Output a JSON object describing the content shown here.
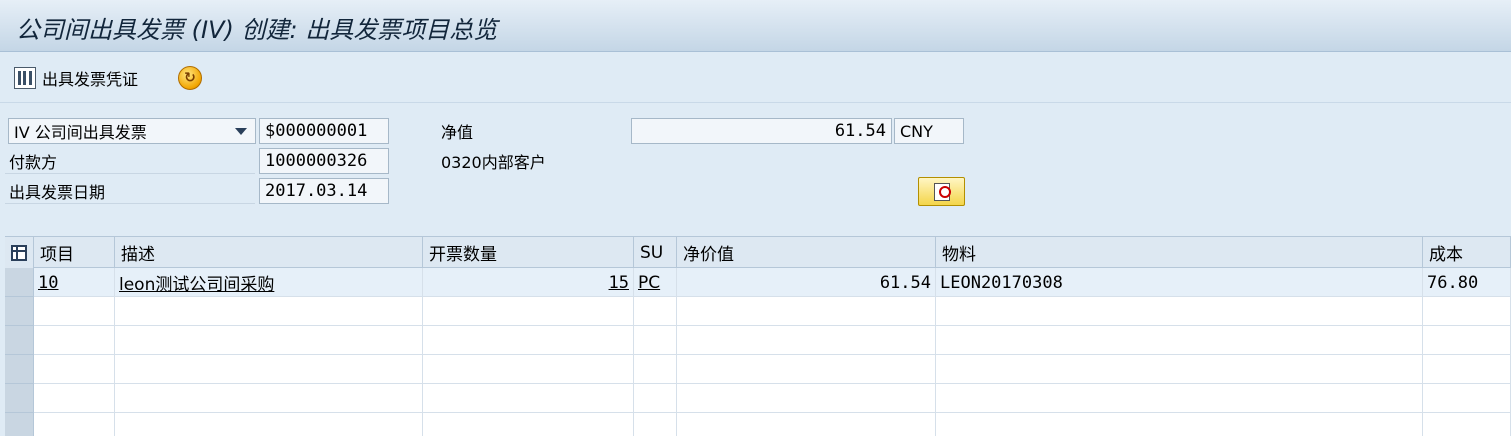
{
  "window": {
    "title": "公司间出具发票 (IV) 创建: 出具发票项目总览"
  },
  "toolbar": {
    "billing_doc_label": "出具发票凭证",
    "billing_doc_icon": "document-columns-icon",
    "refresh_icon": "refresh-icon"
  },
  "header": {
    "billing_type": "IV 公司间出具发票",
    "billing_number": "$000000001",
    "payer_label": "付款方",
    "payer_value": "1000000326",
    "billing_date_label": "出具发票日期",
    "billing_date_value": "2017.03.14",
    "net_value_label": "净值",
    "net_value": "61.54",
    "currency": "CNY",
    "customer_text": "0320内部客户",
    "details_icon": "display-document-icon"
  },
  "table": {
    "columns": [
      "项目",
      "描述",
      "开票数量",
      "SU",
      "净价值",
      "物料",
      "成本"
    ],
    "rows": [
      {
        "item": "10",
        "description": "leon测试公司间采购",
        "quantity": "15",
        "su": "PC",
        "net_value": "61.54",
        "material": "LEON20170308",
        "cost": "76.80"
      }
    ]
  },
  "colors": {
    "background": "#dfebf5",
    "title_bar": "#c4d6e6",
    "selected_row": "#e6f0f9",
    "button_yellow": "#f4d54a"
  }
}
